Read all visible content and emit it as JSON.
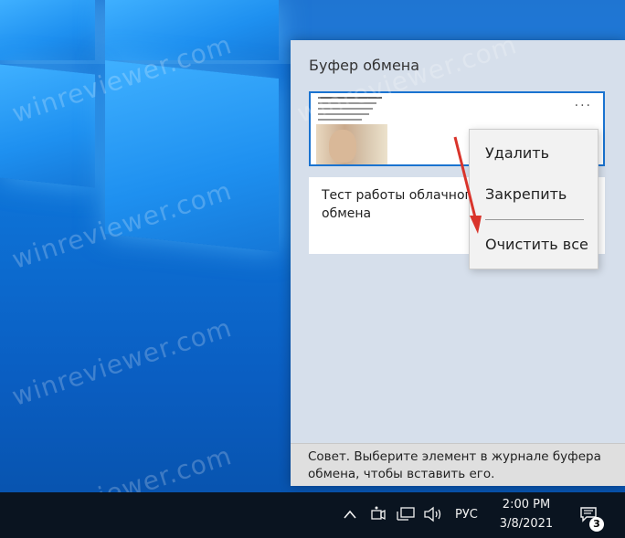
{
  "desktop": {
    "watermark": "winreviewer.com"
  },
  "clipboard": {
    "title": "Буфер обмена",
    "items": [
      {
        "type": "image",
        "more": "···"
      },
      {
        "type": "text",
        "text": "Тест работы облачного обмена"
      }
    ],
    "tip": "Совет. Выберите элемент в журнале буфера обмена, чтобы вставить его."
  },
  "context_menu": {
    "items": [
      "Удалить",
      "Закрепить",
      "Очистить все"
    ]
  },
  "taskbar": {
    "language": "РУС",
    "time": "2:00 PM",
    "date": "3/8/2021",
    "notification_count": "3"
  },
  "colors": {
    "accent": "#1a73d0",
    "annotation_arrow": "#d9342b"
  }
}
